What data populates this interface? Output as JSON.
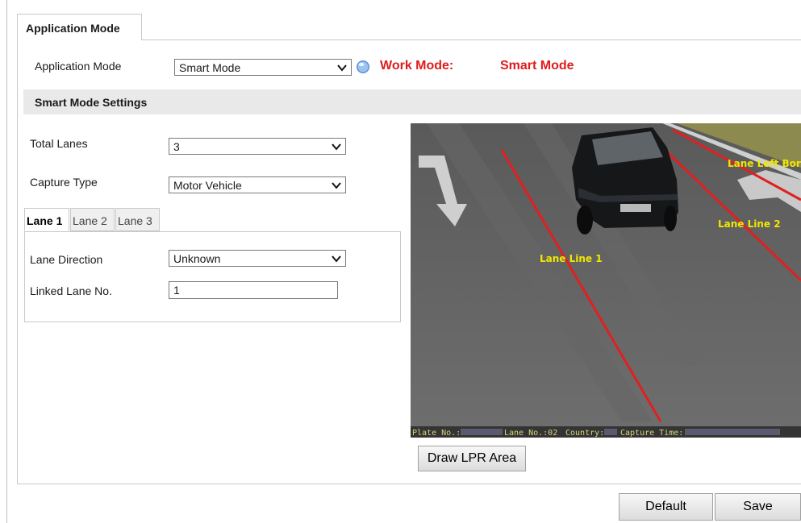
{
  "tabs": {
    "active": "Application Mode"
  },
  "app_mode": {
    "label": "Application Mode",
    "selected": "Smart Mode",
    "work_mode_label": "Work Mode:",
    "work_mode_value": "Smart Mode"
  },
  "section": {
    "title": "Smart Mode Settings"
  },
  "total_lanes": {
    "label": "Total Lanes",
    "selected": "3"
  },
  "capture_type": {
    "label": "Capture Type",
    "selected": "Motor Vehicle"
  },
  "lane_tabs": [
    "Lane 1",
    "Lane 2",
    "Lane 3"
  ],
  "lane": {
    "direction_label": "Lane Direction",
    "direction_selected": "Unknown",
    "linked_label": "Linked Lane No.",
    "linked_value": "1"
  },
  "camera": {
    "overlay_labels": [
      "Lane Line 1",
      "Lane Line 2",
      "Lane Left Border"
    ],
    "osd": {
      "plate": "Plate No.:",
      "lane": "Lane No.:02",
      "country": "Country:",
      "capture": "Capture Time:"
    }
  },
  "buttons": {
    "draw_lpr": "Draw LPR Area",
    "default": "Default",
    "save": "Save"
  },
  "colors": {
    "accent": "#e01b1b",
    "lane_line": "#e02020",
    "overlay_text": "#f2e600"
  }
}
